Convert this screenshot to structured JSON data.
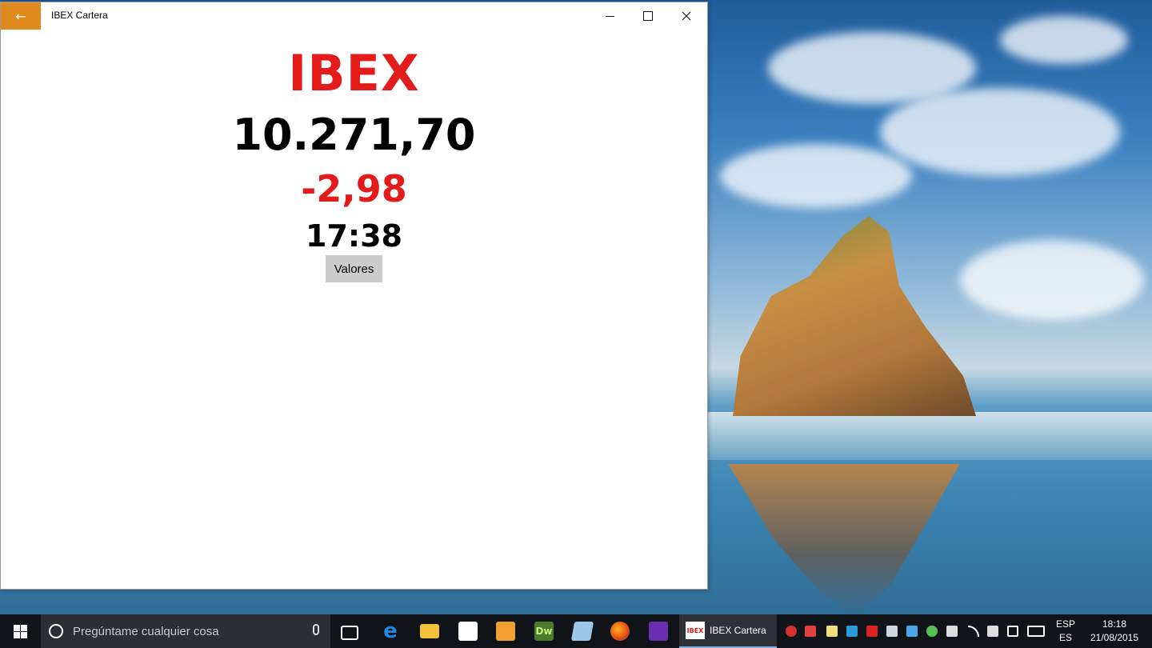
{
  "window": {
    "title": "IBEX Cartera",
    "back_icon": "arrow-left-icon",
    "controls": [
      "minimize-icon",
      "maximize-icon",
      "close-icon"
    ]
  },
  "main": {
    "ticker": "IBEX",
    "value": "10.271,70",
    "change": "-2,98",
    "time": "17:38",
    "button_label": "Valores"
  },
  "colors": {
    "ticker": "#e41b1b",
    "change": "#e41b1b",
    "back_button": "#e08a1e",
    "button_bg": "#cccccc"
  },
  "taskbar": {
    "search_placeholder": "Pregúntame cualquier cosa",
    "running_app_label": "IBEX Cartera",
    "running_app_logo": "IBEX",
    "pinned_icons": [
      "task-view-icon",
      "edge-icon",
      "file-explorer-icon",
      "store-icon",
      "media-player-icon",
      "dreamweaver-icon",
      "notepad-icon",
      "firefox-icon",
      "visual-studio-icon"
    ],
    "dw_label": "Dw",
    "lang_top": "ESP",
    "lang_bottom": "ES",
    "time": "18:18",
    "date": "21/08/2015"
  }
}
